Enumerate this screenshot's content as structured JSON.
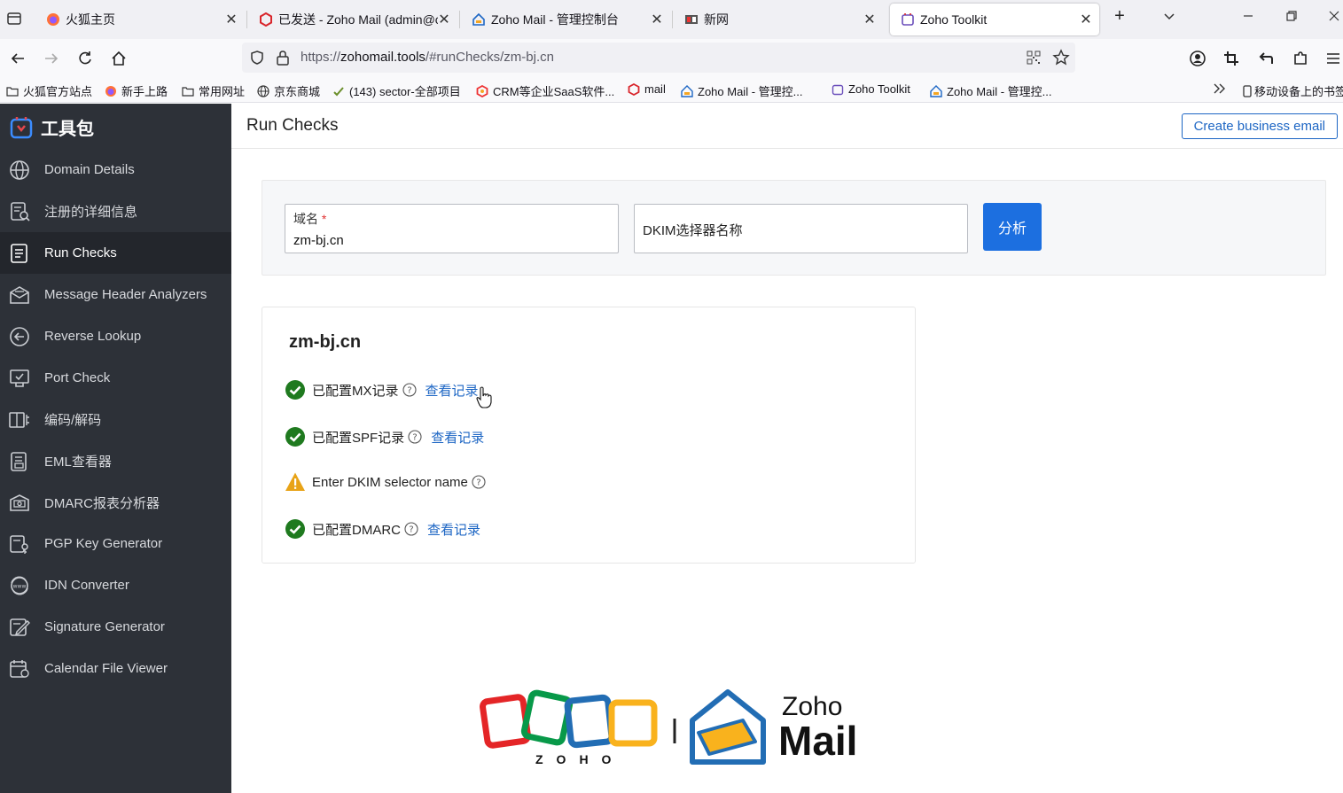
{
  "browser": {
    "tabs": [
      {
        "title": "火狐主页",
        "icon": "firefox-icon",
        "active": false
      },
      {
        "title": "已发送 - Zoho Mail (admin@c",
        "icon": "zoho-mail-red-icon",
        "active": false
      },
      {
        "title": "Zoho Mail - 管理控制台",
        "icon": "zoho-house-icon",
        "active": false
      },
      {
        "title": "新网",
        "icon": "xinnet-icon",
        "active": false
      },
      {
        "title": "Zoho Toolkit",
        "icon": "zoho-toolkit-icon",
        "active": true
      }
    ],
    "url_prefix": "https://",
    "url_domain": "zohomail.tools",
    "url_path": "/#runChecks/zm-bj.cn",
    "bookmarks": [
      {
        "label": "火狐官方站点",
        "icon": "folder-icon"
      },
      {
        "label": "新手上路",
        "icon": "firefox-icon"
      },
      {
        "label": "常用网址",
        "icon": "folder-icon"
      },
      {
        "label": "京东商城",
        "icon": "globe-icon"
      },
      {
        "label": "(143) sector-全部项目",
        "icon": "check-bookmark-icon"
      },
      {
        "label": "CRM等企业SaaS软件...",
        "icon": "crm-icon"
      },
      {
        "label": "mail",
        "icon": "zoho-mail-red-icon"
      },
      {
        "label": "Zoho Mail - 管理控...",
        "icon": "zoho-house-icon"
      },
      {
        "label": "Zoho Toolkit",
        "icon": "zoho-toolkit-icon"
      },
      {
        "label": "Zoho Mail - 管理控...",
        "icon": "zoho-house-icon"
      }
    ],
    "mobile_bookmarks": "移动设备上的书签"
  },
  "app": {
    "brand": "工具包",
    "page_title": "Run Checks",
    "create_button": "Create business email",
    "sidebar": [
      {
        "label": "Domain Details",
        "icon": "globe-icon"
      },
      {
        "label": "注册的详细信息",
        "icon": "registration-icon"
      },
      {
        "label": "Run Checks",
        "icon": "checklist-icon",
        "active": true
      },
      {
        "label": "Message Header Analyzers",
        "icon": "mail-analyzer-icon"
      },
      {
        "label": "Reverse Lookup",
        "icon": "reverse-lookup-icon"
      },
      {
        "label": "Port Check",
        "icon": "port-shield-icon"
      },
      {
        "label": "编码/解码",
        "icon": "encode-decode-icon"
      },
      {
        "label": "EML查看器",
        "icon": "eml-viewer-icon"
      },
      {
        "label": "DMARC报表分析器",
        "icon": "dmarc-report-icon"
      },
      {
        "label": "PGP Key Generator",
        "icon": "pgp-key-icon"
      },
      {
        "label": "IDN Converter",
        "icon": "idn-converter-icon"
      },
      {
        "label": "Signature Generator",
        "icon": "signature-icon"
      },
      {
        "label": "Calendar File Viewer",
        "icon": "calendar-icon"
      }
    ],
    "form": {
      "domain_label": "域名",
      "domain_required_mark": "*",
      "domain_value": "zm-bj.cn",
      "dkim_placeholder": "DKIM选择器名称",
      "analyze_button": "分析"
    },
    "results": {
      "domain": "zm-bj.cn",
      "checks": [
        {
          "status": "ok",
          "label": "已配置MX记录",
          "link": "查看记录"
        },
        {
          "status": "ok",
          "label": "已配置SPF记录",
          "link": "查看记录"
        },
        {
          "status": "warning",
          "label": "Enter DKIM selector name",
          "link": ""
        },
        {
          "status": "ok",
          "label": "已配置DMARC",
          "link": "查看记录"
        }
      ]
    },
    "footer": {
      "zoho_wordmark": "ZOHO",
      "mail_brand_top": "Zoho",
      "mail_brand_bottom": "Mail"
    },
    "colors": {
      "sidebar_bg": "#2d3138",
      "accent_blue": "#1c6fe0",
      "ok_green": "#1f7a1f",
      "warning_orange": "#e8a317"
    }
  }
}
